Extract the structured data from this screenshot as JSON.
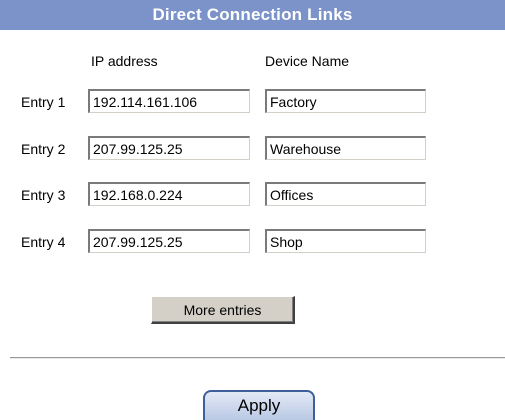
{
  "header": {
    "title": "Direct Connection Links",
    "background_color": "#7b93c8"
  },
  "columns": {
    "ip_address": "IP address",
    "device_name": "Device Name"
  },
  "entries": [
    {
      "label": "Entry 1",
      "ip": "192.114.161.106",
      "name": "Factory"
    },
    {
      "label": "Entry 2",
      "ip": "207.99.125.25",
      "name": "Warehouse"
    },
    {
      "label": "Entry 3",
      "ip": "192.168.0.224",
      "name": "Offices"
    },
    {
      "label": "Entry 4",
      "ip": "207.99.125.25",
      "name": "Shop"
    }
  ],
  "buttons": {
    "more_entries": "More entries",
    "apply": "Apply"
  }
}
